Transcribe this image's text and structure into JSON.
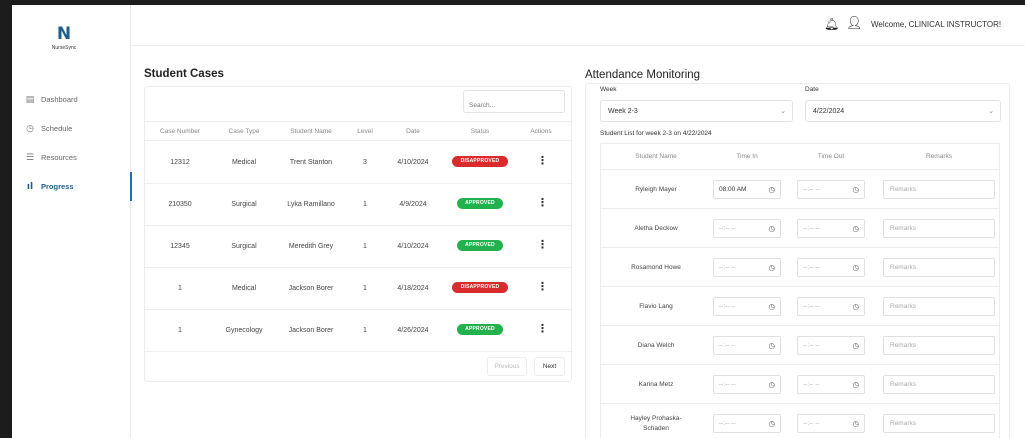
{
  "brand": {
    "mark": "N",
    "name": "NurseSync"
  },
  "sidebar": {
    "items": [
      {
        "label": "Dashboard",
        "icon": "calendar-icon"
      },
      {
        "label": "Schedule",
        "icon": "clock-icon"
      },
      {
        "label": "Resources",
        "icon": "list-icon"
      },
      {
        "label": "Progress",
        "icon": "bar-chart-icon",
        "active": true
      }
    ]
  },
  "header": {
    "welcome": "Welcome, CLINICAL INSTRUCTOR!",
    "bell_icon": "bell-icon",
    "user_icon": "user-icon"
  },
  "cases": {
    "title": "Student Cases",
    "search_placeholder": "Search...",
    "columns": [
      "Case Number",
      "Case Type",
      "Student Name",
      "Level",
      "Date",
      "Status",
      "Actions"
    ],
    "rows": [
      {
        "case_number": "12312",
        "case_type": "Medical",
        "student": "Trent Stanton",
        "level": "3",
        "date": "4/10/2024",
        "status": "DISAPPROVED"
      },
      {
        "case_number": "210350",
        "case_type": "Surgical",
        "student": "Lyka Ramillano",
        "level": "1",
        "date": "4/9/2024",
        "status": "APPROVED"
      },
      {
        "case_number": "12345",
        "case_type": "Surgical",
        "student": "Meredith Grey",
        "level": "1",
        "date": "4/10/2024",
        "status": "APPROVED"
      },
      {
        "case_number": "1",
        "case_type": "Medical",
        "student": "Jackson Borer",
        "level": "1",
        "date": "4/18/2024",
        "status": "DISAPPROVED"
      },
      {
        "case_number": "1",
        "case_type": "Gynecology",
        "student": "Jackson Borer",
        "level": "1",
        "date": "4/26/2024",
        "status": "APPROVED"
      }
    ],
    "previous_label": "Previous",
    "next_label": "Next"
  },
  "attendance": {
    "title": "Attendance Monitoring",
    "week_label": "Week",
    "week_value": "Week 2-3",
    "date_label": "Date",
    "date_value": "4/22/2024",
    "list_label": "Student List for week 2-3 on 4/22/2024",
    "columns": [
      "Student Name",
      "Time In",
      "Time Out",
      "Remarks"
    ],
    "time_placeholder": "--:-- --",
    "remarks_placeholder": "Remarks",
    "rows": [
      {
        "name": "Ryleigh Mayer",
        "time_in": "08:00 AM"
      },
      {
        "name": "Aletha Deckow",
        "time_in": ""
      },
      {
        "name": "Rosamond Howe",
        "time_in": ""
      },
      {
        "name": "Flavio Lang",
        "time_in": ""
      },
      {
        "name": "Diana Welch",
        "time_in": ""
      },
      {
        "name": "Karina Metz",
        "time_in": ""
      },
      {
        "name": "Hayley Prohaska-Schaden",
        "time_in": ""
      }
    ]
  },
  "colors": {
    "brand": "#1f5f8b",
    "approved": "#22b14c",
    "disapproved": "#d92b2b"
  }
}
